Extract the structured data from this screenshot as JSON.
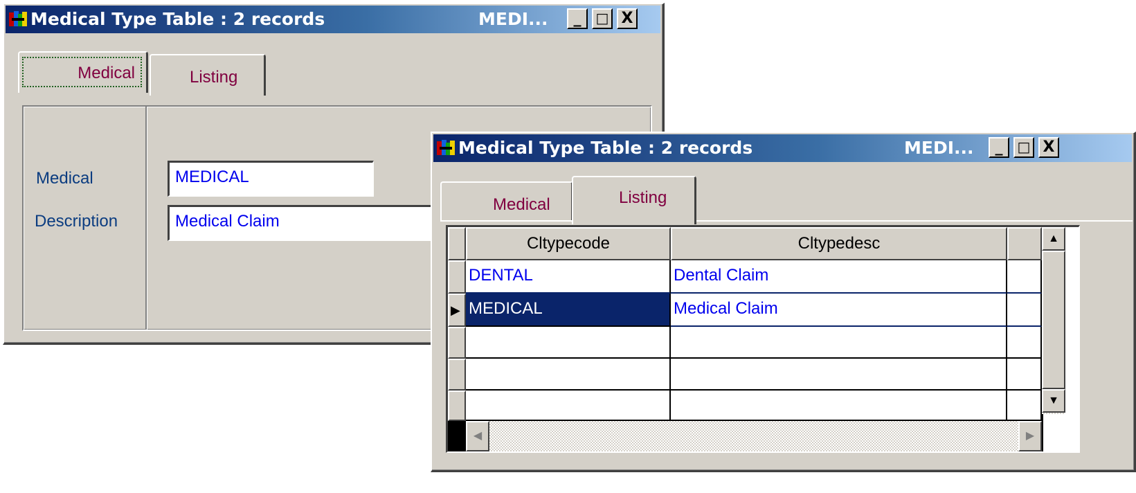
{
  "back_window": {
    "title": "Medical Type Table : 2 records",
    "title_right": "MEDI...",
    "controls": {
      "minimize": "_",
      "maximize": "□",
      "close": "X"
    },
    "tabs": [
      {
        "label": "Medical",
        "active": true
      },
      {
        "label": "Listing",
        "active": false
      }
    ],
    "form": {
      "medical_label": "Medical",
      "medical_value": "MEDICAL",
      "description_label": "Description",
      "description_value": "Medical Claim"
    }
  },
  "front_window": {
    "title": "Medical Type Table : 2 records",
    "title_right": "MEDI...",
    "controls": {
      "minimize": "_",
      "maximize": "□",
      "close": "X"
    },
    "tabs": [
      {
        "label": "Medical",
        "active": false
      },
      {
        "label": "Listing",
        "active": true
      }
    ],
    "grid": {
      "columns": [
        "Cltypecode",
        "Cltypedesc"
      ],
      "rows": [
        {
          "code": "DENTAL",
          "desc": "Dental Claim",
          "selected": false
        },
        {
          "code": "MEDICAL",
          "desc": "Medical Claim",
          "selected": true
        }
      ],
      "record_pointer": "▶"
    },
    "scrollbar": {
      "up": "▲",
      "down": "▼",
      "left": "◀",
      "right": "▶"
    }
  },
  "colors": {
    "window_face": "#d4d0c8",
    "title_gradient_start": "#0a246a",
    "title_gradient_end": "#a6caf0",
    "tab_text": "#800040",
    "label_text": "#0b3c80",
    "value_text": "#0000ee",
    "selected_row": "#0a246a"
  },
  "icons": [
    "app-icon",
    "minimize-icon",
    "maximize-icon",
    "close-icon",
    "scroll-up-icon",
    "scroll-down-icon",
    "scroll-left-icon",
    "scroll-right-icon",
    "record-pointer-icon"
  ]
}
